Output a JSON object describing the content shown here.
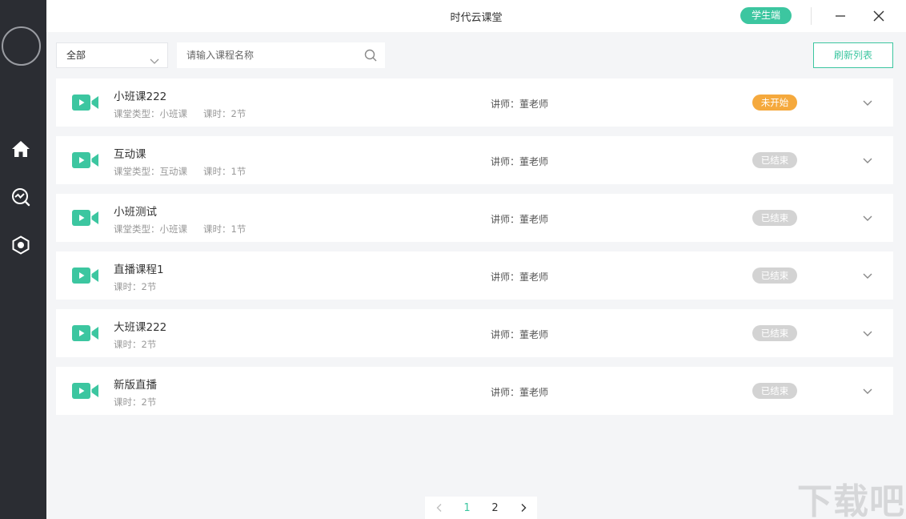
{
  "app": {
    "title": "时代云课堂",
    "role_badge": "学生端"
  },
  "colors": {
    "accent": "#3cc6a0",
    "status_pending": "#f5a93d",
    "status_ended": "#d3d3d3",
    "sidebar_bg": "#2b2d33"
  },
  "sidebar": {
    "items": [
      {
        "name": "home",
        "icon": "home-icon"
      },
      {
        "name": "monitor",
        "icon": "chart-search-icon"
      },
      {
        "name": "settings",
        "icon": "hexagon-settings-icon"
      }
    ]
  },
  "filter": {
    "selected": "全部"
  },
  "search": {
    "placeholder": "请输入课程名称",
    "value": ""
  },
  "toolbar": {
    "refresh_label": "刷新列表"
  },
  "courses": [
    {
      "name": "小班课222",
      "type": "课堂类型：小班课",
      "hours": "课时：2节",
      "teacher": "讲师：董老师",
      "status": "未开始",
      "state": "pending"
    },
    {
      "name": "互动课",
      "type": "课堂类型：互动课",
      "hours": "课时：1节",
      "teacher": "讲师：董老师",
      "status": "已结束",
      "state": "ended"
    },
    {
      "name": "小班测试",
      "type": "课堂类型：小班课",
      "hours": "课时：1节",
      "teacher": "讲师：董老师",
      "status": "已结束",
      "state": "ended"
    },
    {
      "name": "直播课程1",
      "type": "",
      "hours": "课时：2节",
      "teacher": "讲师：董老师",
      "status": "已结束",
      "state": "ended"
    },
    {
      "name": "大班课222",
      "type": "",
      "hours": "课时：2节",
      "teacher": "讲师：董老师",
      "status": "已结束",
      "state": "ended"
    },
    {
      "name": "新版直播",
      "type": "",
      "hours": "课时：2节",
      "teacher": "讲师：董老师",
      "status": "已结束",
      "state": "ended"
    }
  ],
  "pagination": {
    "pages": [
      "1",
      "2"
    ],
    "current": "1"
  },
  "watermark": {
    "text": "下载吧"
  }
}
